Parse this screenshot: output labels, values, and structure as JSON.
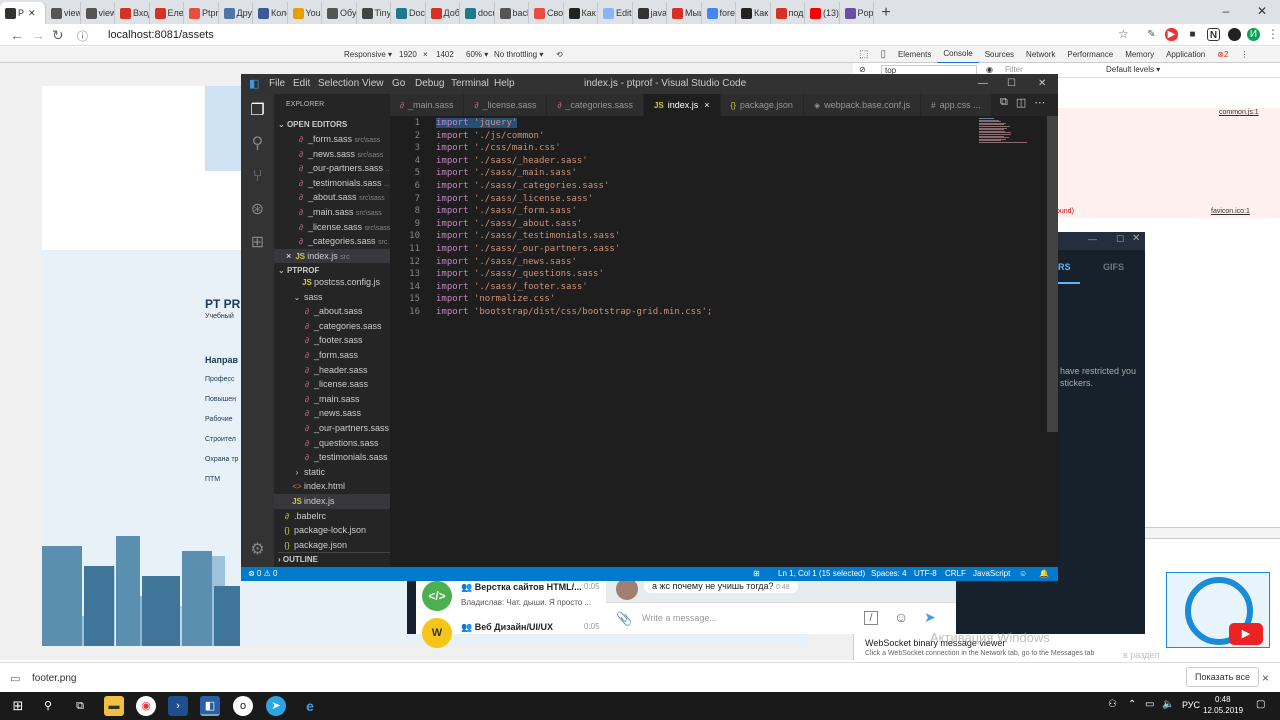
{
  "browser": {
    "tabs": [
      {
        "label": "P",
        "favicon_color": "#333333",
        "active": true
      },
      {
        "label": "view",
        "favicon_color": "#555555"
      },
      {
        "label": "view",
        "favicon_color": "#555555"
      },
      {
        "label": "Вход",
        "favicon_color": "#d93025"
      },
      {
        "label": "Елен",
        "favicon_color": "#d93025"
      },
      {
        "label": "Ptpro",
        "favicon_color": "#e84d3d"
      },
      {
        "label": "Друз",
        "favicon_color": "#4a76a8"
      },
      {
        "label": "Коле",
        "favicon_color": "#3b5998"
      },
      {
        "label": "You t",
        "favicon_color": "#e8a000"
      },
      {
        "label": "Обуч",
        "favicon_color": "#555555"
      },
      {
        "label": "TinyF",
        "favicon_color": "#444444"
      },
      {
        "label": "Docu",
        "favicon_color": "#1b7a8c"
      },
      {
        "label": "Добе",
        "favicon_color": "#d93025"
      },
      {
        "label": "docu",
        "favicon_color": "#1b7a8c"
      },
      {
        "label": "back",
        "favicon_color": "#555555"
      },
      {
        "label": "Свої",
        "favicon_color": "#e84d3d"
      },
      {
        "label": "Как с",
        "favicon_color": "#222222"
      },
      {
        "label": "Edit t",
        "favicon_color": "#8ab4f8"
      },
      {
        "label": "java",
        "favicon_color": "#333333"
      },
      {
        "label": "Мыш",
        "favicon_color": "#d93025"
      },
      {
        "label": "fore",
        "favicon_color": "#4285f4"
      },
      {
        "label": "Как с",
        "favicon_color": "#222222"
      },
      {
        "label": "под",
        "favicon_color": "#d93025"
      },
      {
        "label": "(13)",
        "favicon_color": "#ff0000"
      },
      {
        "label": "Popp",
        "favicon_color": "#6a4fa3"
      }
    ],
    "new_tab_glyph": "+",
    "url": "localhost:8081/assets"
  },
  "devtools_toolbar": {
    "device": "Responsive ▾",
    "width": "1920",
    "height": "1402",
    "zoom": "60% ▾",
    "throttle": "No throttling ▾"
  },
  "devtools": {
    "tabs": [
      "Elements",
      "Console",
      "Sources",
      "Network",
      "Performance",
      "Memory",
      "Application"
    ],
    "active_tab": "Console",
    "errors": "2",
    "context": "top",
    "filter_placeholder": "Filter",
    "levels": "Default levels ▾",
    "console_link_1": "common.js:1",
    "console_link_2": "favicon.ico:1",
    "console_err_tail": "ound)",
    "ws_title": "WebSocket binary message viewer",
    "ws_desc": "Click a WebSocket connection in the Network tab, go to the Messages tab"
  },
  "site": {
    "logo": "PT PR",
    "logo_sub": "Учебный",
    "nav_title": "Направ",
    "nav_items": [
      "Професс",
      "Повышен",
      "Рабочие",
      "Строител",
      "Охрана тр",
      "ПТМ"
    ]
  },
  "telegram": {
    "tab_gifs": "GIFS",
    "tab_stickers_partial": "RS",
    "restricted_text_1": "have restricted you",
    "restricted_text_2": "stickers.",
    "chats": [
      {
        "title": "Верстка сайтов HTML/...",
        "time": "0:05",
        "preview": "Владислав: Чат. дыши. Я просто ..."
      },
      {
        "title": "Веб Дизайн/UI/UX",
        "time": "0:05"
      }
    ],
    "message": "а жс почему не учишь тогда?",
    "message_time": "0:48",
    "input_placeholder": "Write a message...",
    "watermark": "Активация Windows",
    "watermark_sub": "в раздел"
  },
  "vscode": {
    "menu": [
      "File",
      "Edit",
      "Selection",
      "View",
      "Go",
      "Debug",
      "Terminal",
      "Help"
    ],
    "title": "index.js - ptprof - Visual Studio Code",
    "explorer_title": "EXPLORER",
    "open_editors_label": "OPEN EDITORS",
    "open_editors": [
      {
        "name": "_form.sass",
        "path": "src\\sass",
        "type": "sass"
      },
      {
        "name": "_news.sass",
        "path": "src\\sass",
        "type": "sass"
      },
      {
        "name": "_our-partners.sass",
        "path": "...",
        "type": "sass"
      },
      {
        "name": "_testimonials.sass",
        "path": "...",
        "type": "sass"
      },
      {
        "name": "_about.sass",
        "path": "src\\sass",
        "type": "sass"
      },
      {
        "name": "_main.sass",
        "path": "src\\sass",
        "type": "sass"
      },
      {
        "name": "_license.sass",
        "path": "src\\sass",
        "type": "sass"
      },
      {
        "name": "_categories.sass",
        "path": "src...",
        "type": "sass"
      },
      {
        "name": "index.js",
        "path": "src",
        "type": "js",
        "close": "×"
      }
    ],
    "project_label": "PTPROF",
    "tree": [
      {
        "name": "postcss.config.js",
        "type": "js",
        "indent": 2
      },
      {
        "name": "sass",
        "type": "folder",
        "indent": 1
      },
      {
        "name": "_about.sass",
        "type": "sass",
        "indent": 2
      },
      {
        "name": "_categories.sass",
        "type": "sass",
        "indent": 2
      },
      {
        "name": "_footer.sass",
        "type": "sass",
        "indent": 2
      },
      {
        "name": "_form.sass",
        "type": "sass",
        "indent": 2
      },
      {
        "name": "_header.sass",
        "type": "sass",
        "indent": 2
      },
      {
        "name": "_license.sass",
        "type": "sass",
        "indent": 2
      },
      {
        "name": "_main.sass",
        "type": "sass",
        "indent": 2
      },
      {
        "name": "_news.sass",
        "type": "sass",
        "indent": 2
      },
      {
        "name": "_our-partners.sass",
        "type": "sass",
        "indent": 2
      },
      {
        "name": "_questions.sass",
        "type": "sass",
        "indent": 2
      },
      {
        "name": "_testimonials.sass",
        "type": "sass",
        "indent": 2
      },
      {
        "name": "static",
        "type": "folder-closed",
        "indent": 1
      },
      {
        "name": "index.html",
        "type": "html",
        "indent": 1
      },
      {
        "name": "index.js",
        "type": "js",
        "indent": 1,
        "selected": true
      },
      {
        "name": ".babelrc",
        "type": "babel",
        "indent": 0
      },
      {
        "name": "package-lock.json",
        "type": "json",
        "indent": 0
      },
      {
        "name": "package.json",
        "type": "json",
        "indent": 0
      }
    ],
    "outline_label": "OUTLINE",
    "editor_tabs": [
      {
        "name": "_main.sass",
        "type": "sass"
      },
      {
        "name": "_license.sass",
        "type": "sass"
      },
      {
        "name": "_categories.sass",
        "type": "sass"
      },
      {
        "name": "index.js",
        "type": "js",
        "active": true,
        "close": "×"
      },
      {
        "name": "package.json",
        "type": "json"
      },
      {
        "name": "webpack.base.conf.js",
        "type": "webpack"
      },
      {
        "name": "app.css ...",
        "type": "css"
      }
    ],
    "code_lines": [
      {
        "kw": "import",
        "str": "'jquery'",
        "selected": true
      },
      {
        "kw": "import",
        "str": "'./js/common'"
      },
      {
        "kw": "import",
        "str": "'./css/main.css'"
      },
      {
        "kw": "import",
        "str": "'./sass/_header.sass'"
      },
      {
        "kw": "import",
        "str": "'./sass/_main.sass'"
      },
      {
        "kw": "import",
        "str": "'./sass/_categories.sass'"
      },
      {
        "kw": "import",
        "str": "'./sass/_license.sass'"
      },
      {
        "kw": "import",
        "str": "'./sass/_form.sass'"
      },
      {
        "kw": "import",
        "str": "'./sass/_about.sass'"
      },
      {
        "kw": "import",
        "str": "'./sass/_testimonials.sass'"
      },
      {
        "kw": "import",
        "str": "'./sass/_our-partners.sass'"
      },
      {
        "kw": "import",
        "str": "'./sass/_news.sass'"
      },
      {
        "kw": "import",
        "str": "'./sass/_questions.sass'"
      },
      {
        "kw": "import",
        "str": "'./sass/_footer.sass'"
      },
      {
        "kw": "import",
        "str": "'normalize.css'"
      },
      {
        "kw": "import",
        "str": "'bootstrap/dist/css/bootstrap-grid.min.css';"
      }
    ],
    "status": {
      "problems": "⊗ 0 ⚠ 0",
      "position": "Ln 1, Col 1 (15 selected)",
      "spaces": "Spaces: 4",
      "encoding": "UTF-8",
      "eol": "CRLF",
      "language": "JavaScript"
    },
    "accent": "#007acc"
  },
  "downloads": {
    "file": "footer.png",
    "show_all": "Показать все",
    "close": "×"
  },
  "taskbar": {
    "lang": "РУС",
    "time": "0:48",
    "date": "12.05.2019"
  }
}
